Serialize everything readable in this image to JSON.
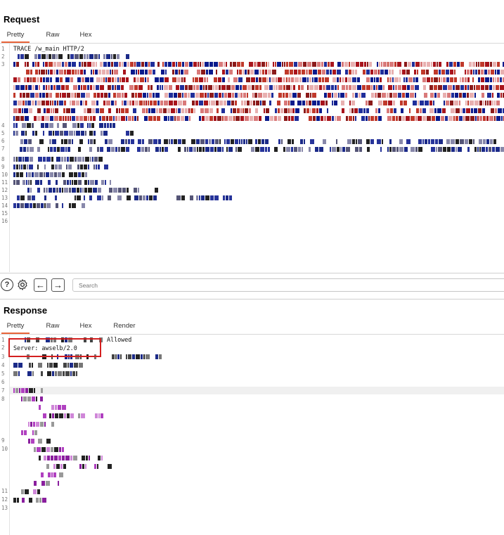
{
  "request": {
    "title": "Request",
    "tabs": [
      "Pretty",
      "Raw",
      "Hex"
    ],
    "active_tab": "Pretty",
    "line_numbers": [
      "1",
      "2",
      "3",
      "4",
      "5",
      "6",
      "7",
      "8",
      "9",
      "10",
      "11",
      "12",
      "13",
      "14",
      "15",
      "16"
    ],
    "first_line": "TRACE /w_main HTTP/2",
    "redacted": true
  },
  "toolbar": {
    "help_icon": "question-circle-icon",
    "settings_icon": "gear-icon",
    "back_icon": "arrow-left-icon",
    "forward_icon": "arrow-right-icon",
    "search_placeholder": "Search"
  },
  "response": {
    "title": "Response",
    "tabs": [
      "Pretty",
      "Raw",
      "Hex",
      "Render"
    ],
    "active_tab": "Pretty",
    "line_numbers": [
      "1",
      "2",
      "3",
      "4",
      "5",
      "6",
      "7",
      "8",
      "9",
      "10",
      "11",
      "12",
      "13"
    ],
    "status_line_visible_part": "Allowed",
    "server_line": "Server: awselb/2.0",
    "highlight_color": "#d42020",
    "redacted": true
  }
}
